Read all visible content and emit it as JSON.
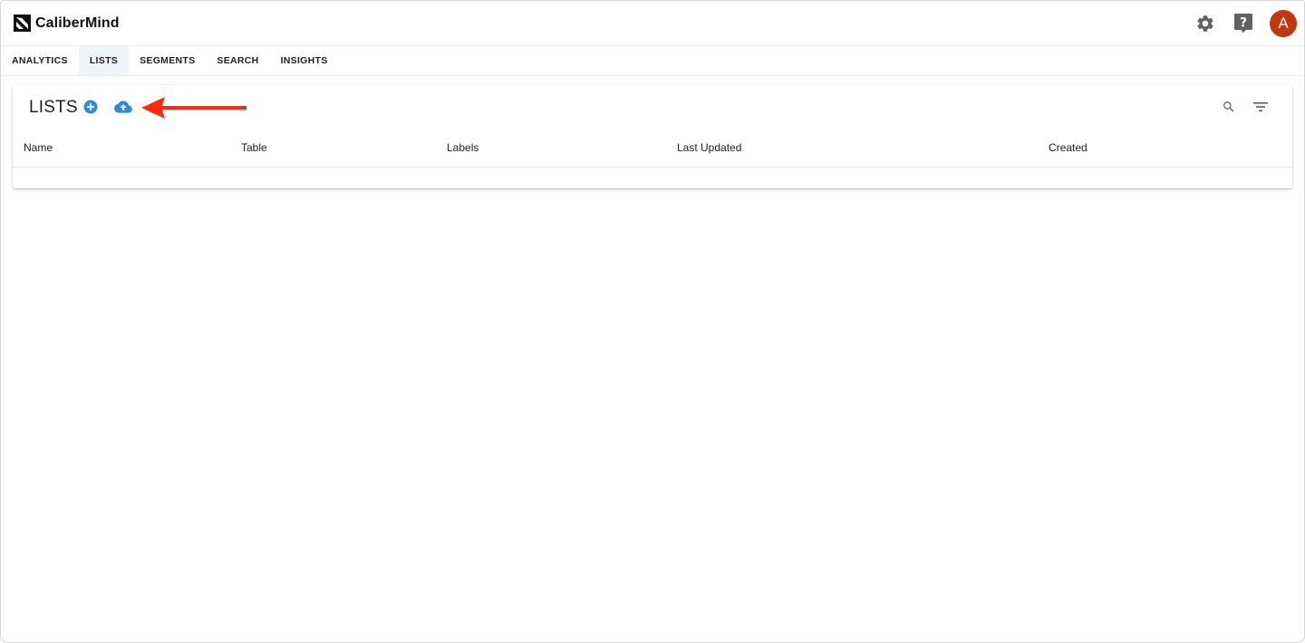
{
  "app": {
    "brand": "CaliberMind",
    "user_initial": "A",
    "colors": {
      "accent_blue": "#2a8dd8",
      "avatar_bg": "#c0370f",
      "annotation_arrow": "#ff2a0d"
    }
  },
  "header": {
    "icons": [
      "logo-mark",
      "gear-icon",
      "help-icon",
      "avatar"
    ]
  },
  "nav": {
    "tabs": [
      {
        "label": "ANALYTICS",
        "active": false
      },
      {
        "label": "LISTS",
        "active": true
      },
      {
        "label": "SEGMENTS",
        "active": false
      },
      {
        "label": "SEARCH",
        "active": false
      },
      {
        "label": "INSIGHTS",
        "active": false
      }
    ]
  },
  "lists_card": {
    "title": "LISTS",
    "action_icons": [
      "add-circle-icon",
      "cloud-upload-icon",
      "search-icon",
      "filter-icon"
    ],
    "columns": [
      "Name",
      "Table",
      "Labels",
      "Last Updated",
      "Created"
    ],
    "rows": []
  },
  "annotation": {
    "type": "arrow",
    "points_to": "cloud-upload-icon"
  }
}
